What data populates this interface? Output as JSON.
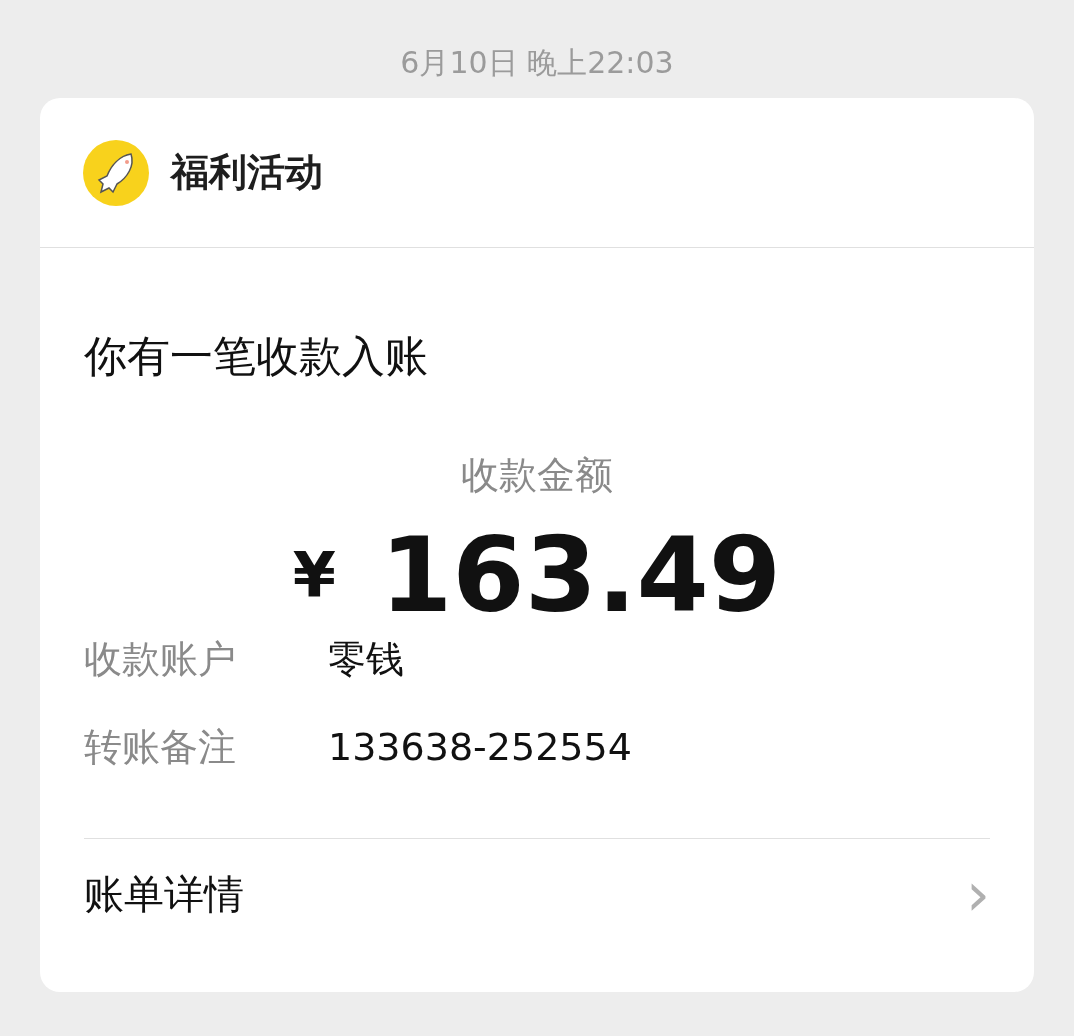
{
  "timestamp": "6月10日 晚上22:03",
  "card": {
    "sender": "福利活动",
    "title": "你有一笔收款入账",
    "amount_label": "收款金额",
    "currency": "¥",
    "amount": "163.49",
    "fields": [
      {
        "label": "收款账户",
        "value": "零钱"
      },
      {
        "label": "转账备注",
        "value": "133638-252554"
      }
    ],
    "footer": {
      "label": "账单详情",
      "arrow": "›"
    }
  }
}
